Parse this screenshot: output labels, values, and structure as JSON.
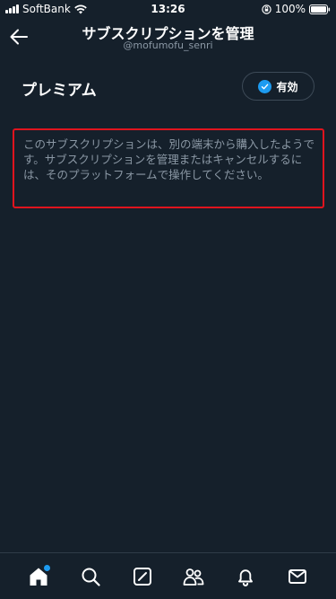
{
  "status_bar": {
    "carrier": "SoftBank",
    "time": "13:26",
    "battery": "100%"
  },
  "header": {
    "title": "サブスクリプションを管理",
    "username": "@mofumofu_senri"
  },
  "premium": {
    "label": "プレミアム",
    "status": "有効"
  },
  "info": {
    "message": "このサブスクリプションは、別の端末から購入したようです。サブスクリプションを管理またはキャンセルするには、そのプラットフォームで操作してください。"
  },
  "colors": {
    "background": "#15202b",
    "accent": "#1d9bf0",
    "highlight_border": "#e0141e",
    "muted_text": "#8b98a5"
  },
  "bottom_nav": {
    "items": [
      "home-icon",
      "search-icon",
      "compose-icon",
      "communities-icon",
      "notifications-icon",
      "messages-icon"
    ]
  }
}
